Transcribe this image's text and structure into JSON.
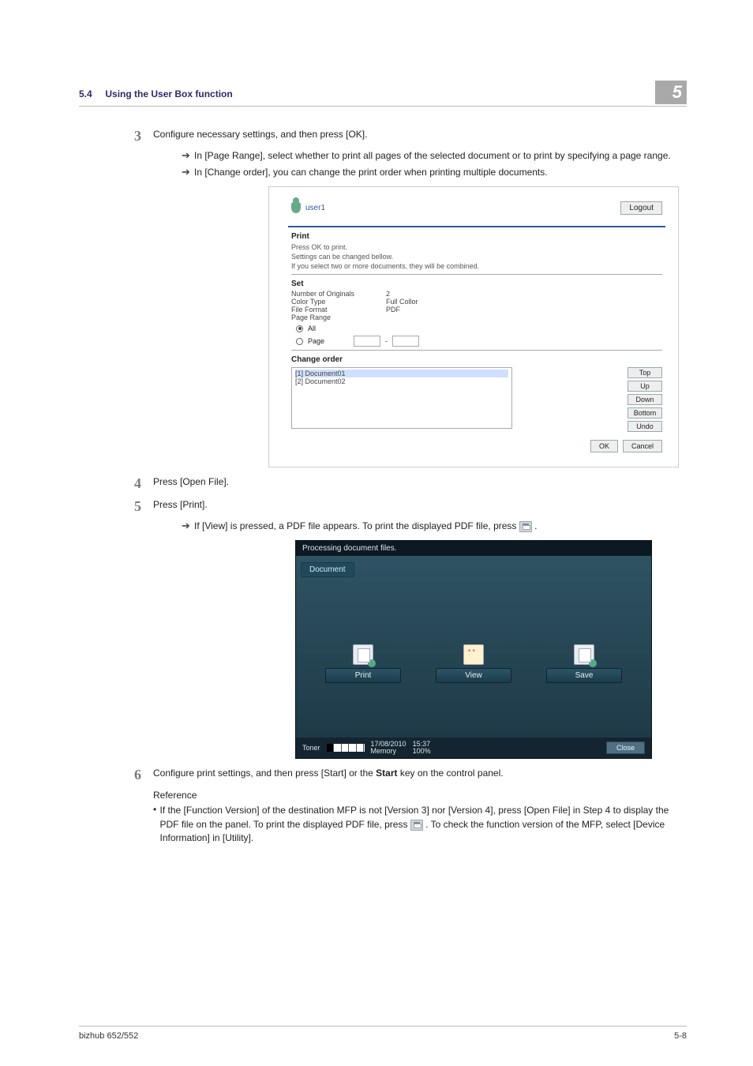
{
  "header": {
    "section": "5.4",
    "title": "Using the User Box function",
    "chapter_badge": "5"
  },
  "steps": {
    "s3": {
      "num": "3",
      "text": "Configure necessary settings, and then press [OK].",
      "sub1": "In [Page Range], select whether to print all pages of the selected document or to print by specifying a page range.",
      "sub2": "In [Change order], you can change the print order when printing multiple documents."
    },
    "s4": {
      "num": "4",
      "text": "Press [Open File]."
    },
    "s5": {
      "num": "5",
      "text": "Press [Print].",
      "sub1_pre": "If [View] is pressed, a PDF file appears. To print the displayed PDF file, press ",
      "sub1_post": "."
    },
    "s6": {
      "num": "6",
      "text_pre": "Configure print settings, and then press [Start] or the ",
      "bold": "Start",
      "text_post": " key on the control panel."
    }
  },
  "reference": {
    "label": "Reference",
    "item1_a": "If the [Function Version] of the destination MFP is not [Version 3] nor [Version 4], press [Open File] in Step 4 to display the PDF file on the panel. To print the displayed PDF file, press ",
    "item1_b": ". To check the function version of the MFP, select [Device Information] in [Utility]."
  },
  "web_dialog": {
    "user": "user1",
    "logout": "Logout",
    "heading": "Print",
    "note1": "Press OK to print.",
    "note2": "Settings can be changed bellow.",
    "note3": "If you select two or more documents, they will be combined.",
    "set_heading": "Set",
    "rows": {
      "r1k": "Number of Originals",
      "r1v": "2",
      "r2k": "Color Type",
      "r2v": "Full Collor",
      "r3k": "File Format",
      "r3v": "PDF",
      "r4k": "Page Range",
      "r4v": ""
    },
    "radio_all": "All",
    "radio_page": "Page",
    "page_sep": "-",
    "order_heading": "Change order",
    "order_items": [
      "[1] Document01",
      "[2] Document02"
    ],
    "order_btns": {
      "top": "Top",
      "up": "Up",
      "down": "Down",
      "bottom": "Bottom",
      "undo": "Undo"
    },
    "ok": "OK",
    "cancel": "Cancel"
  },
  "panel": {
    "status": "Processing document files.",
    "tab": "Document",
    "btns": {
      "print": "Print",
      "view": "View",
      "save": "Save"
    },
    "toner_label": "Toner",
    "date": "17/08/2010",
    "time": "15:37",
    "mem_label": "Memory",
    "mem_pct": "100%",
    "close": "Close"
  },
  "footer": {
    "left": "bizhub 652/552",
    "right": "5-8"
  }
}
